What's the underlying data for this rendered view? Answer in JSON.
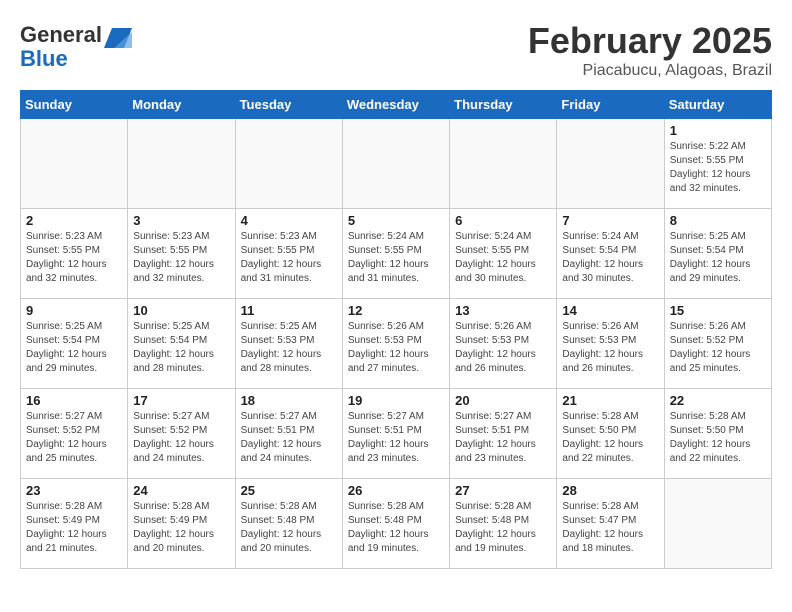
{
  "header": {
    "logo_line1": "General",
    "logo_line2": "Blue",
    "month": "February 2025",
    "location": "Piacabucu, Alagoas, Brazil"
  },
  "weekdays": [
    "Sunday",
    "Monday",
    "Tuesday",
    "Wednesday",
    "Thursday",
    "Friday",
    "Saturday"
  ],
  "weeks": [
    [
      {
        "day": "",
        "info": ""
      },
      {
        "day": "",
        "info": ""
      },
      {
        "day": "",
        "info": ""
      },
      {
        "day": "",
        "info": ""
      },
      {
        "day": "",
        "info": ""
      },
      {
        "day": "",
        "info": ""
      },
      {
        "day": "1",
        "info": "Sunrise: 5:22 AM\nSunset: 5:55 PM\nDaylight: 12 hours\nand 32 minutes."
      }
    ],
    [
      {
        "day": "2",
        "info": "Sunrise: 5:23 AM\nSunset: 5:55 PM\nDaylight: 12 hours\nand 32 minutes."
      },
      {
        "day": "3",
        "info": "Sunrise: 5:23 AM\nSunset: 5:55 PM\nDaylight: 12 hours\nand 32 minutes."
      },
      {
        "day": "4",
        "info": "Sunrise: 5:23 AM\nSunset: 5:55 PM\nDaylight: 12 hours\nand 31 minutes."
      },
      {
        "day": "5",
        "info": "Sunrise: 5:24 AM\nSunset: 5:55 PM\nDaylight: 12 hours\nand 31 minutes."
      },
      {
        "day": "6",
        "info": "Sunrise: 5:24 AM\nSunset: 5:55 PM\nDaylight: 12 hours\nand 30 minutes."
      },
      {
        "day": "7",
        "info": "Sunrise: 5:24 AM\nSunset: 5:54 PM\nDaylight: 12 hours\nand 30 minutes."
      },
      {
        "day": "8",
        "info": "Sunrise: 5:25 AM\nSunset: 5:54 PM\nDaylight: 12 hours\nand 29 minutes."
      }
    ],
    [
      {
        "day": "9",
        "info": "Sunrise: 5:25 AM\nSunset: 5:54 PM\nDaylight: 12 hours\nand 29 minutes."
      },
      {
        "day": "10",
        "info": "Sunrise: 5:25 AM\nSunset: 5:54 PM\nDaylight: 12 hours\nand 28 minutes."
      },
      {
        "day": "11",
        "info": "Sunrise: 5:25 AM\nSunset: 5:53 PM\nDaylight: 12 hours\nand 28 minutes."
      },
      {
        "day": "12",
        "info": "Sunrise: 5:26 AM\nSunset: 5:53 PM\nDaylight: 12 hours\nand 27 minutes."
      },
      {
        "day": "13",
        "info": "Sunrise: 5:26 AM\nSunset: 5:53 PM\nDaylight: 12 hours\nand 26 minutes."
      },
      {
        "day": "14",
        "info": "Sunrise: 5:26 AM\nSunset: 5:53 PM\nDaylight: 12 hours\nand 26 minutes."
      },
      {
        "day": "15",
        "info": "Sunrise: 5:26 AM\nSunset: 5:52 PM\nDaylight: 12 hours\nand 25 minutes."
      }
    ],
    [
      {
        "day": "16",
        "info": "Sunrise: 5:27 AM\nSunset: 5:52 PM\nDaylight: 12 hours\nand 25 minutes."
      },
      {
        "day": "17",
        "info": "Sunrise: 5:27 AM\nSunset: 5:52 PM\nDaylight: 12 hours\nand 24 minutes."
      },
      {
        "day": "18",
        "info": "Sunrise: 5:27 AM\nSunset: 5:51 PM\nDaylight: 12 hours\nand 24 minutes."
      },
      {
        "day": "19",
        "info": "Sunrise: 5:27 AM\nSunset: 5:51 PM\nDaylight: 12 hours\nand 23 minutes."
      },
      {
        "day": "20",
        "info": "Sunrise: 5:27 AM\nSunset: 5:51 PM\nDaylight: 12 hours\nand 23 minutes."
      },
      {
        "day": "21",
        "info": "Sunrise: 5:28 AM\nSunset: 5:50 PM\nDaylight: 12 hours\nand 22 minutes."
      },
      {
        "day": "22",
        "info": "Sunrise: 5:28 AM\nSunset: 5:50 PM\nDaylight: 12 hours\nand 22 minutes."
      }
    ],
    [
      {
        "day": "23",
        "info": "Sunrise: 5:28 AM\nSunset: 5:49 PM\nDaylight: 12 hours\nand 21 minutes."
      },
      {
        "day": "24",
        "info": "Sunrise: 5:28 AM\nSunset: 5:49 PM\nDaylight: 12 hours\nand 20 minutes."
      },
      {
        "day": "25",
        "info": "Sunrise: 5:28 AM\nSunset: 5:48 PM\nDaylight: 12 hours\nand 20 minutes."
      },
      {
        "day": "26",
        "info": "Sunrise: 5:28 AM\nSunset: 5:48 PM\nDaylight: 12 hours\nand 19 minutes."
      },
      {
        "day": "27",
        "info": "Sunrise: 5:28 AM\nSunset: 5:48 PM\nDaylight: 12 hours\nand 19 minutes."
      },
      {
        "day": "28",
        "info": "Sunrise: 5:28 AM\nSunset: 5:47 PM\nDaylight: 12 hours\nand 18 minutes."
      },
      {
        "day": "",
        "info": ""
      }
    ]
  ]
}
